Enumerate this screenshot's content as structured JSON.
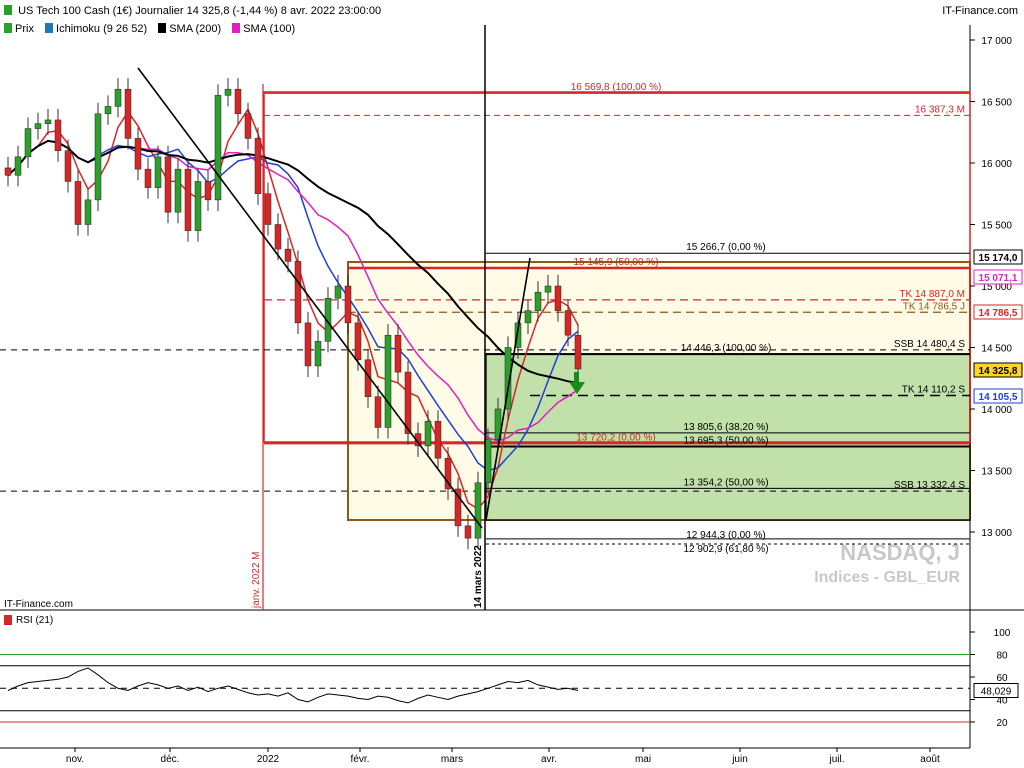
{
  "header": {
    "title": "US Tech 100 Cash (1€) Journalier 14 325,8 (-1,44 %) 8 avr. 2022 23:00:00",
    "brand": "IT-Finance.com"
  },
  "legend": [
    {
      "label": "Prix",
      "color": "#2ca02c"
    },
    {
      "label": "Ichimoku (9 26 52)",
      "color": "#1f77b4"
    },
    {
      "label": "SMA (200)",
      "color": "#000000"
    },
    {
      "label": "SMA (100)",
      "color": "#e020c0"
    }
  ],
  "watermark": {
    "line1": "NASDAQ, J",
    "line2": "Indices - GBL_EUR"
  },
  "footer_brand": "IT-Finance.com",
  "rsi_label": "RSI (21)",
  "chart_data": {
    "type": "candlestick",
    "y_ticks": [
      13000,
      13500,
      14000,
      14500,
      15000,
      15500,
      16000,
      16500,
      17000
    ],
    "y_tick_labels": [
      "13 000",
      "13 500",
      "14 000",
      "14 500",
      "15 000",
      "15 500",
      "16 000",
      "16 500",
      "17 000"
    ],
    "ylim": [
      12850,
      17050
    ],
    "x_labels": [
      "nov.",
      "déc.",
      "2022",
      "févr.",
      "mars",
      "avr.",
      "mai",
      "juin",
      "juil.",
      "août"
    ],
    "vertical_markers": [
      "janv. 2022 M",
      "14 mars 2022"
    ],
    "price_boxes": [
      {
        "text": "15 174,0",
        "value": 15174.0,
        "color": "#000000"
      },
      {
        "text": "15 071,1",
        "value": 15071.1,
        "color": "#e020c0"
      },
      {
        "text": "14 786,5",
        "value": 14786.5,
        "color": "#d62728"
      },
      {
        "text": "14 325,8",
        "value": 14325.8,
        "color": "#000000"
      },
      {
        "text": "14 105,5",
        "value": 14105.5,
        "color": "#1f3fd6"
      }
    ],
    "levels": [
      {
        "text": "16 569,8 (100,00 %)",
        "value": 16569.8,
        "color": "#d62728"
      },
      {
        "text": "16 387,3 M",
        "value": 16387.3,
        "color": "#d62728"
      },
      {
        "text": "15 266,7 (0,00 %)",
        "value": 15266.7,
        "color": "#000000"
      },
      {
        "text": "15 145,9 (50,00 %)",
        "value": 15145.9,
        "color": "#d62728"
      },
      {
        "text": "TK 14 887,0 M",
        "value": 14887.0,
        "color": "#d62728"
      },
      {
        "text": "TK 14 786,5 J",
        "value": 14786.5,
        "color": "#8b5a1a"
      },
      {
        "text": "14 446,3 (100,00 %)",
        "value": 14446.3,
        "color": "#000000"
      },
      {
        "text": "SSB 14 480,4 S",
        "value": 14480.4,
        "color": "#000000"
      },
      {
        "text": "TK 14 110,2 S",
        "value": 14110.2,
        "color": "#000000"
      },
      {
        "text": "13 805,6 (38,20 %)",
        "value": 13805.6,
        "color": "#000000"
      },
      {
        "text": "13 720,2 (0,00 %)",
        "value": 13720.2,
        "color": "#d62728"
      },
      {
        "text": "13 695,3 (50,00 %)",
        "value": 13695.3,
        "color": "#000000"
      },
      {
        "text": "13 354,2 (50,00 %)",
        "value": 13354.2,
        "color": "#000000"
      },
      {
        "text": "SSB 13 332,4 S",
        "value": 13332.4,
        "color": "#000000"
      },
      {
        "text": "12 944,3 (0,00 %)",
        "value": 12944.3,
        "color": "#000000"
      },
      {
        "text": "12 902,9 (61,80 %)",
        "value": 12902.9,
        "color": "#000000"
      }
    ],
    "close_series": [
      15900,
      16050,
      16280,
      16320,
      16350,
      16100,
      15850,
      15500,
      15700,
      16400,
      16460,
      16600,
      16200,
      15950,
      15800,
      16050,
      15600,
      15950,
      15450,
      15850,
      15700,
      16550,
      16600,
      16400,
      16200,
      15750,
      15500,
      15300,
      15200,
      14700,
      14350,
      14550,
      14900,
      15000,
      14700,
      14400,
      14100,
      13850,
      14600,
      14300,
      13800,
      13700,
      13900,
      13600,
      13350,
      13050,
      12950,
      13400,
      13750,
      14000,
      14500,
      14700,
      14800,
      14950,
      15000,
      14800,
      14600,
      14326
    ],
    "rsi": {
      "ylim": [
        0,
        100
      ],
      "ticks": [
        20,
        40,
        60,
        80,
        100
      ],
      "reference_lines": [
        70,
        50,
        30
      ],
      "current": "48,029",
      "values": [
        48,
        52,
        55,
        56,
        57,
        58,
        60,
        65,
        68,
        62,
        55,
        50,
        48,
        52,
        55,
        53,
        50,
        52,
        48,
        51,
        47,
        50,
        52,
        49,
        46,
        44,
        45,
        43,
        46,
        40,
        38,
        42,
        45,
        44,
        43,
        41,
        40,
        43,
        42,
        39,
        37,
        41,
        44,
        42,
        40,
        43,
        45,
        47,
        50,
        53,
        56,
        55,
        57,
        53,
        51,
        49,
        50,
        48
      ]
    },
    "rsi_x_labels": [
      "nov.",
      "déc.",
      "2022",
      "févr.",
      "mars",
      "avr.",
      "mai",
      "juin",
      "juil.",
      "août"
    ]
  }
}
